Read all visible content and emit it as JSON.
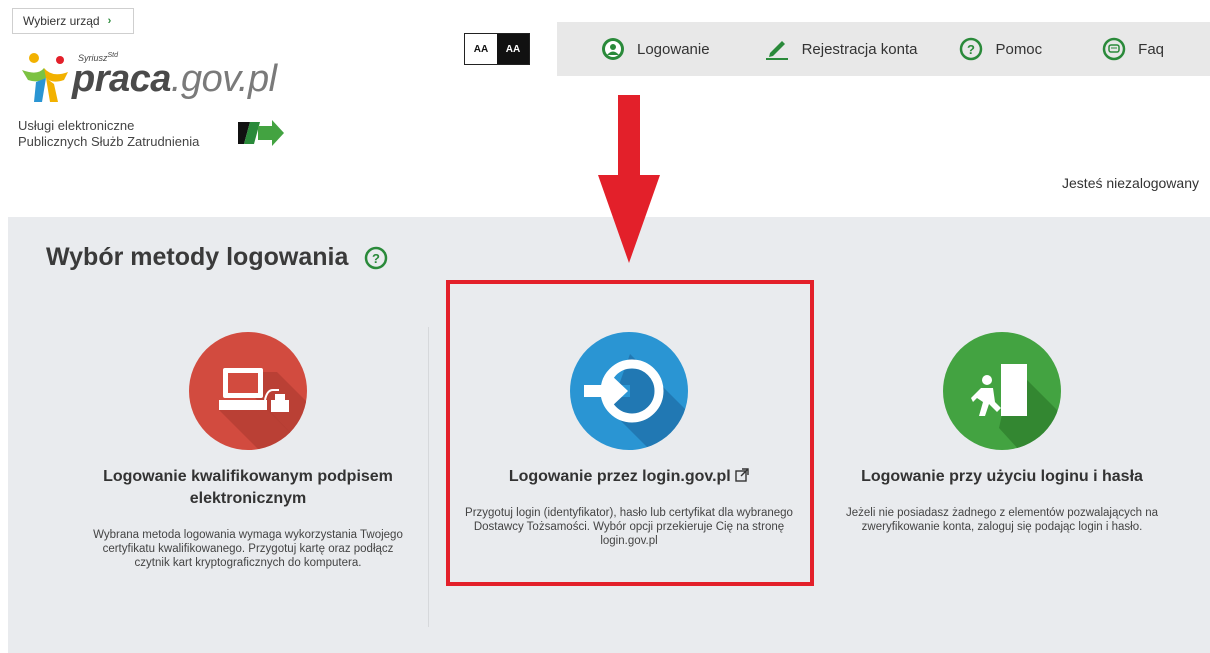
{
  "header": {
    "office_button": "Wybierz urząd",
    "logo_super": "Syriusz",
    "logo_super_sup": "Std",
    "logo_word": "praca",
    "logo_suffix": ".gov.pl",
    "subtitle_line1": "Usługi elektroniczne",
    "subtitle_line2": "Publicznych Służb Zatrudnienia",
    "contrast_normal": "AA",
    "contrast_high": "AA",
    "status": "Jesteś niezalogowany"
  },
  "nav": {
    "items": [
      {
        "label": "Logowanie",
        "icon": "user-circle-icon"
      },
      {
        "label": "Rejestracja konta",
        "icon": "pencil-icon"
      },
      {
        "label": "Pomoc",
        "icon": "question-circle-icon"
      },
      {
        "label": "Faq",
        "icon": "chat-bubble-icon"
      }
    ]
  },
  "main": {
    "title": "Wybór metody logowania",
    "methods": [
      {
        "title": "Logowanie kwalifikowanym podpisem elektronicznym",
        "description": "Wybrana metoda logowania wymaga wykorzystania Twojego certyfikatu kwalifikowanego. Przygotuj kartę oraz podłącz czytnik kart kryptograficznych do komputera.",
        "icon": "card-reader-computer-icon",
        "color": "#d24b3f"
      },
      {
        "title": "Logowanie przez login.gov.pl",
        "description": "Przygotuj login (identyfikator), hasło lub certyfikat dla wybranego Dostawcy Tożsamości. Wybór opcji przekieruje Cię na stronę login.gov.pl",
        "icon": "login-arrow-icon",
        "color": "#2a95d3"
      },
      {
        "title": "Logowanie przy użyciu loginu i hasła",
        "description": "Jeżeli nie posiadasz żadnego z elementów pozwalających na zweryfikowanie konta, zaloguj się podając login i hasło.",
        "icon": "person-door-icon",
        "color": "#43a341"
      }
    ]
  },
  "colors": {
    "accent_red": "#e3202a",
    "nav_bg": "#e8e8e8",
    "panel_bg": "#e9ebee",
    "green": "#2a8a3a"
  }
}
